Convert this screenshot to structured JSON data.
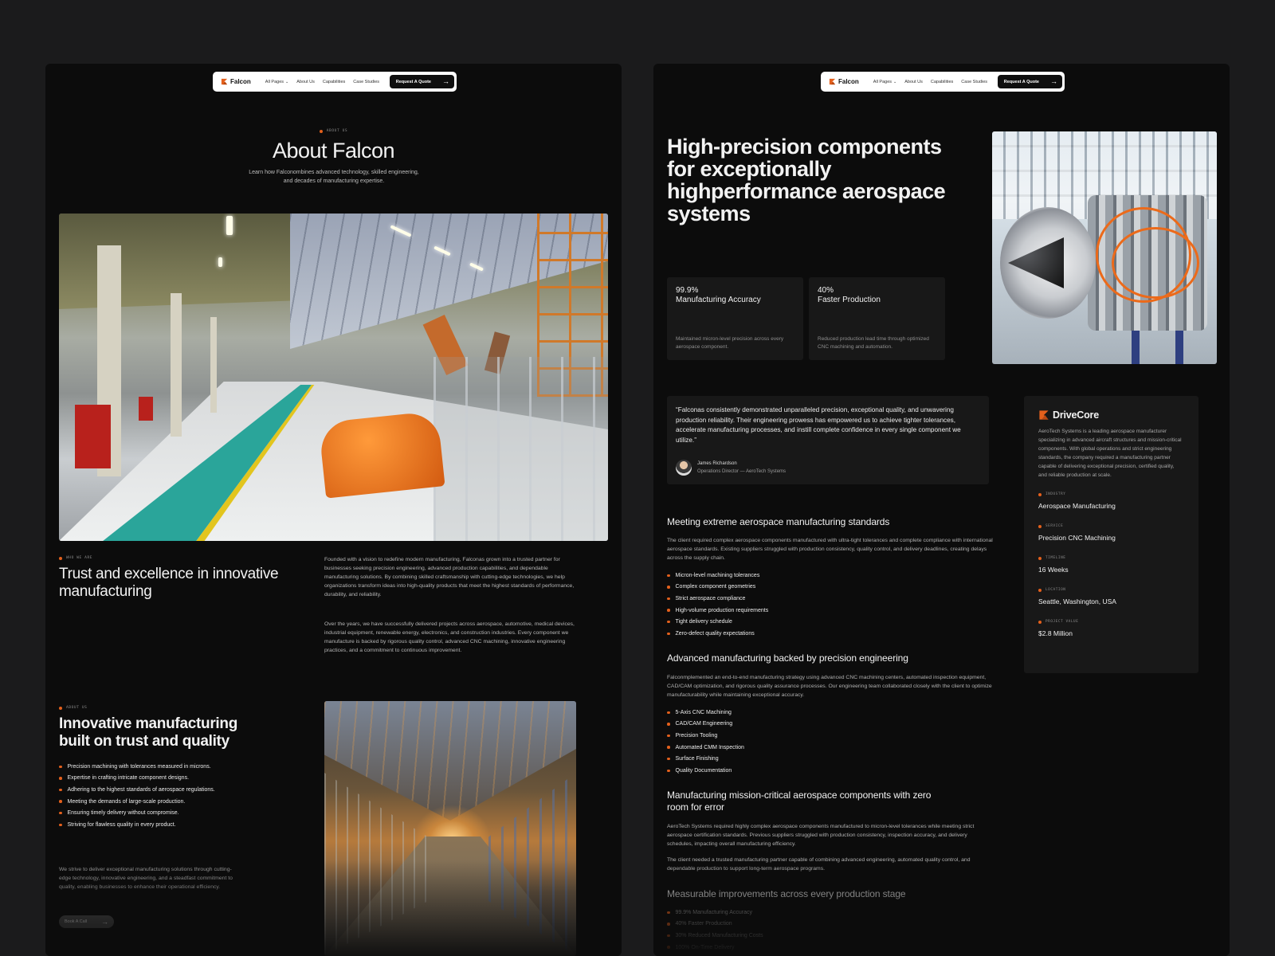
{
  "brand": {
    "name": "Falcon",
    "accent": "#e4601c"
  },
  "nav": {
    "all_pages": "All Pages",
    "about": "About Us",
    "capabilities": "Capabilities",
    "case_studies": "Case Studies",
    "cta": "Request A Quote"
  },
  "about_page": {
    "eyebrow": "ABOUT US",
    "title": "About Falcon",
    "subtitle": "Learn how Falconombines advanced technology, skilled engineering, and decades of manufacturing expertise.",
    "who": {
      "eyebrow": "WHO WE ARE",
      "title": "Trust and excellence in innovative manufacturing",
      "p1": "Founded with a vision to redefine modern manufacturing, Falconas grown into a trusted partner for businesses seeking precision engineering, advanced production capabilities, and dependable manufacturing solutions. By combining skilled craftsmanship with cutting-edge technologies, we help organizations transform ideas into high-quality products that meet the highest standards of performance, durability, and reliability.",
      "p2": "Over the years, we have successfully delivered projects across aerospace, automotive, medical devices, industrial equipment, renewable energy, electronics, and construction industries. Every component we manufacture is backed by rigorous quality control, advanced CNC machining, innovative engineering practices, and a commitment to continuous improvement."
    },
    "about2": {
      "eyebrow": "ABOUT US",
      "title": "Innovative manufacturing built on trust and quality",
      "items": [
        "Precision machining with tolerances measured in microns.",
        "Expertise in crafting intricate component designs.",
        "Adhering to the highest standards of aerospace regulations.",
        "Meeting the demands of large-scale production.",
        "Ensuring timely delivery without compromise.",
        "Striving for flawless quality in every product."
      ],
      "para": "We strive to deliver exceptional manufacturing solutions through cutting-edge technology, innovative engineering, and a steadfast commitment to quality, enabling businesses to enhance their operational efficiency.",
      "button": "Book A Call"
    }
  },
  "case_page": {
    "title": "High-precision components for exceptionally highperformance aerospace systems",
    "stats": [
      {
        "value": "99.9%",
        "label": "Manufacturing Accuracy",
        "desc": "Maintained micron-level precision across every aerospace component."
      },
      {
        "value": "40%",
        "label": "Faster Production",
        "desc": "Reduced production lead time through optimized CNC machining and automation."
      }
    ],
    "quote": {
      "text": "“Falconas consistently demonstrated unparalleled precision, exceptional quality, and unwavering production reliability. Their engineering prowess has empowered us to achieve tighter tolerances, accelerate manufacturing processes, and instill complete confidence in every single component we utilize.”",
      "author": "James Richardson",
      "role": "Operations Director — AeroTech Systems"
    },
    "client": {
      "name": "DriveCore",
      "desc": "AeroTech Systems is a leading aerospace manufacturer specializing in advanced aircraft structures and mission-critical components. With global operations and strict engineering standards, the company required a manufacturing partner capable of delivering exceptional precision, certified quality, and reliable production at scale.",
      "meta": [
        {
          "label": "INDUSTRY",
          "value": "Aerospace Manufacturing"
        },
        {
          "label": "SERVICE",
          "value": "Precision CNC Machining"
        },
        {
          "label": "TIMELINE",
          "value": "16 Weeks"
        },
        {
          "label": "LOCATION",
          "value": "Seattle, Washington, USA"
        },
        {
          "label": "PROJECT VALUE",
          "value": "$2.8 Million"
        }
      ]
    },
    "s1": {
      "title": "Meeting extreme aerospace manufacturing standards",
      "para": "The client required complex aerospace components manufactured with ultra-tight tolerances and complete compliance with international aerospace standards. Existing suppliers struggled with production consistency, quality control, and delivery deadlines, creating delays across the supply chain.",
      "items": [
        "Micron-level machining tolerances",
        "Complex component geometries",
        "Strict aerospace compliance",
        "High-volume production requirements",
        "Tight delivery schedule",
        "Zero-defect quality expectations"
      ]
    },
    "s2": {
      "title": "Advanced manufacturing backed by precision engineering",
      "para": "Falconmplemented an end-to-end manufacturing strategy using advanced CNC machining centers, automated inspection equipment, CAD/CAM optimization, and rigorous quality assurance processes. Our engineering team collaborated closely with the client to optimize manufacturability while maintaining exceptional accuracy.",
      "items": [
        "5-Axis CNC Machining",
        "CAD/CAM Engineering",
        "Precision Tooling",
        "Automated CMM Inspection",
        "Surface Finishing",
        "Quality Documentation"
      ]
    },
    "s3": {
      "title": "Manufacturing mission-critical aerospace components with zero room for error",
      "p1": "AeroTech Systems required highly complex aerospace components manufactured to micron-level tolerances while meeting strict aerospace certification standards. Previous suppliers struggled with production consistency, inspection accuracy, and delivery schedules, impacting overall manufacturing efficiency.",
      "p2": "The client needed a trusted manufacturing partner capable of combining advanced engineering, automated quality control, and dependable production to support long-term aerospace programs."
    },
    "s4": {
      "title": "Measurable improvements across every production stage",
      "items": [
        "99.9% Manufacturing Accuracy",
        "40% Faster Production",
        "30% Reduced Manufacturing Costs",
        "100% On-Time Delivery"
      ]
    }
  }
}
